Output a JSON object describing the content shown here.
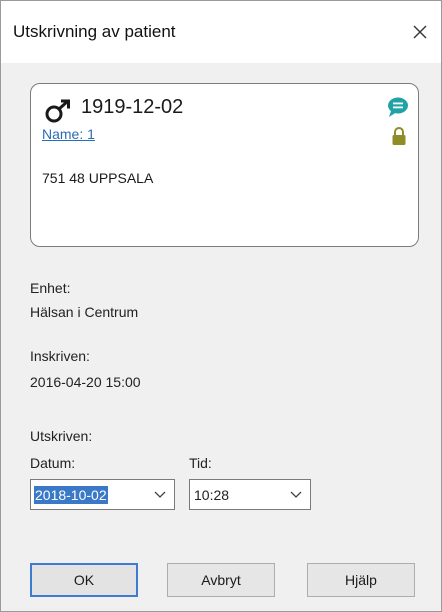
{
  "window": {
    "title": "Utskrivning av patient"
  },
  "patient": {
    "sex_icon": "male-icon",
    "dob": "1919-12-02",
    "name_link": "Name: 1",
    "address": "751 48 UPPSALA",
    "chat_icon": "speech-bubble-icon",
    "lock_icon": "lock-icon"
  },
  "fields": {
    "unit_label": "Enhet:",
    "unit_value": "Hälsan i Centrum",
    "admitted_label": "Inskriven:",
    "admitted_value": "2016-04-20 15:00",
    "discharged_label": "Utskriven:",
    "date_label": "Datum:",
    "date_value": "2018-10-02",
    "time_label": "Tid:",
    "time_value": "10:28"
  },
  "buttons": {
    "ok": "OK",
    "cancel": "Avbryt",
    "help": "Hjälp"
  },
  "colors": {
    "link": "#2a6cb5",
    "chat_icon": "#1fa3a6",
    "lock_icon": "#8f8c2a",
    "selection": "#3a78c8",
    "default_button_border": "#3d7bd1"
  }
}
